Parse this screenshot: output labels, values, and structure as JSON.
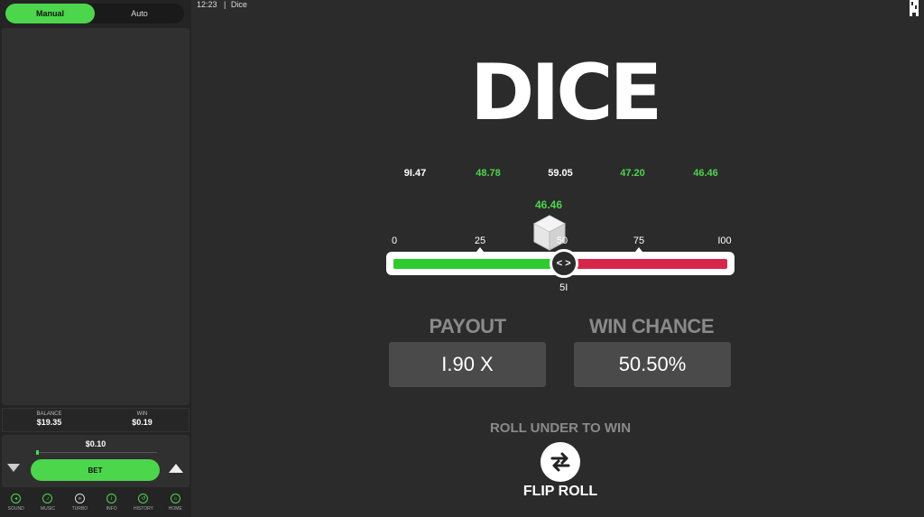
{
  "status_bar": {
    "time": "12:23",
    "separator": "|",
    "app_name": "Dice"
  },
  "sidebar": {
    "modes": [
      {
        "label": "Manual",
        "active": true
      },
      {
        "label": "Auto",
        "active": false
      }
    ],
    "stats": {
      "balance_label": "BALANCE",
      "balance_value": "$19.35",
      "win_label": "WIN",
      "win_value": "$0.19"
    },
    "bet": {
      "amount": "$0.10",
      "bet_label": "BET"
    },
    "nav": [
      {
        "label": "SOUND",
        "icon": "sound-icon"
      },
      {
        "label": "MUSIC",
        "icon": "music-icon"
      },
      {
        "label": "TURBO",
        "icon": "turbo-icon"
      },
      {
        "label": "INFO",
        "icon": "info-icon"
      },
      {
        "label": "HISTORY",
        "icon": "history-icon"
      },
      {
        "label": "HOME",
        "icon": "home-icon"
      }
    ]
  },
  "game": {
    "title": "DICE",
    "history": [
      {
        "value": "9I.47",
        "color": "white"
      },
      {
        "value": "48.78",
        "color": "green"
      },
      {
        "value": "59.05",
        "color": "white"
      },
      {
        "value": "47.20",
        "color": "green"
      },
      {
        "value": "46.46",
        "color": "green"
      }
    ],
    "last_result": "46.46",
    "scale_ticks": [
      "0",
      "25",
      "50",
      "75",
      "I00"
    ],
    "threshold": "5I",
    "threshold_value": 51,
    "handle_glyph": "< >",
    "payout_label": "PAYOUT",
    "payout_value": "I.90 X",
    "win_chance_label": "WIN CHANCE",
    "win_chance_value": "50.50%",
    "roll_mode_label": "ROLL UNDER TO WIN",
    "flip_label": "FLIP ROLL"
  },
  "colors": {
    "accent_green": "#4cd64c",
    "track_red": "#d8264a",
    "background": "#2b2b2b"
  }
}
